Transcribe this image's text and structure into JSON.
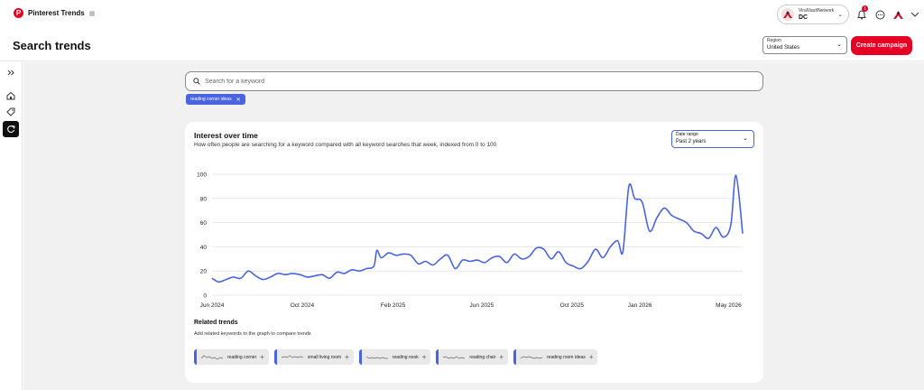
{
  "app": {
    "title": "Pinterest Trends",
    "beta_icon": "grid-icon",
    "logo": "P"
  },
  "account": {
    "network": "ViralVaultNetwork",
    "name": "DC"
  },
  "notifications": {
    "count": "1"
  },
  "page": {
    "title": "Search trends"
  },
  "region": {
    "label": "Region",
    "value": "United States"
  },
  "actions": {
    "create_campaign": "Create campaign"
  },
  "search": {
    "placeholder": "Search for a keyword",
    "value": ""
  },
  "selected_keywords": [
    {
      "label": "reading corner ideas"
    }
  ],
  "interest": {
    "title": "Interest over time",
    "subtitle": "How often people are searching for a keyword compared with all keyword searches that week, indexed from 0 to 100",
    "date_range_label": "Date range",
    "date_range_value": "Past 2 years"
  },
  "related": {
    "title": "Related trends",
    "subtitle": "Add related keywords to the graph to compare trends",
    "items": [
      {
        "label": "reading corner"
      },
      {
        "label": "small living room"
      },
      {
        "label": "reading nook"
      },
      {
        "label": "reading chair"
      },
      {
        "label": "reading room ideas"
      }
    ]
  },
  "colors": {
    "accent": "#e60023",
    "series": "#4a63e0",
    "grid": "#e3e3e3"
  },
  "chart_data": {
    "type": "line",
    "title": "",
    "xlabel": "",
    "ylabel": "",
    "ylim": [
      0,
      100
    ],
    "xlim": [
      "2024-06-01",
      "2026-05-20"
    ],
    "yticks": [
      0,
      20,
      40,
      60,
      80,
      100
    ],
    "xticks": [
      {
        "date": "2024-06-01",
        "label": "Jun 2024"
      },
      {
        "date": "2024-10-01",
        "label": "Oct 2024"
      },
      {
        "date": "2025-02-01",
        "label": "Feb 2025"
      },
      {
        "date": "2025-06-01",
        "label": "Jun 2025"
      },
      {
        "date": "2025-10-01",
        "label": "Oct 2025"
      },
      {
        "date": "2026-01-01",
        "label": "Jan 2026"
      },
      {
        "date": "2026-05-01",
        "label": "May 2026"
      }
    ],
    "grid": true,
    "legend": "none",
    "series": [
      {
        "points": [
          [
            "2024-06-01",
            14
          ],
          [
            "2024-06-10",
            11
          ],
          [
            "2024-06-20",
            13
          ],
          [
            "2024-06-30",
            15
          ],
          [
            "2024-07-10",
            14
          ],
          [
            "2024-07-20",
            20
          ],
          [
            "2024-07-30",
            16
          ],
          [
            "2024-08-09",
            13
          ],
          [
            "2024-08-19",
            15
          ],
          [
            "2024-08-29",
            18
          ],
          [
            "2024-09-08",
            17
          ],
          [
            "2024-09-18",
            18
          ],
          [
            "2024-09-28",
            17
          ],
          [
            "2024-10-08",
            15
          ],
          [
            "2024-10-18",
            16
          ],
          [
            "2024-10-28",
            17
          ],
          [
            "2024-11-07",
            14
          ],
          [
            "2024-11-17",
            19
          ],
          [
            "2024-11-27",
            18
          ],
          [
            "2024-12-07",
            21
          ],
          [
            "2024-12-17",
            20
          ],
          [
            "2024-12-27",
            22
          ],
          [
            "2025-01-06",
            24
          ],
          [
            "2025-01-10",
            37
          ],
          [
            "2025-01-16",
            31
          ],
          [
            "2025-01-26",
            35
          ],
          [
            "2025-02-05",
            33
          ],
          [
            "2025-02-15",
            34
          ],
          [
            "2025-02-25",
            33
          ],
          [
            "2025-03-07",
            26
          ],
          [
            "2025-03-17",
            28
          ],
          [
            "2025-03-27",
            25
          ],
          [
            "2025-04-06",
            30
          ],
          [
            "2025-04-16",
            33
          ],
          [
            "2025-04-26",
            22
          ],
          [
            "2025-05-06",
            29
          ],
          [
            "2025-05-16",
            28
          ],
          [
            "2025-05-26",
            29
          ],
          [
            "2025-06-05",
            27
          ],
          [
            "2025-06-15",
            31
          ],
          [
            "2025-06-25",
            32
          ],
          [
            "2025-07-05",
            27
          ],
          [
            "2025-07-15",
            34
          ],
          [
            "2025-07-25",
            30
          ],
          [
            "2025-08-04",
            32
          ],
          [
            "2025-08-14",
            39
          ],
          [
            "2025-08-24",
            38
          ],
          [
            "2025-09-03",
            30
          ],
          [
            "2025-09-13",
            36
          ],
          [
            "2025-09-23",
            27
          ],
          [
            "2025-10-03",
            24
          ],
          [
            "2025-10-13",
            22
          ],
          [
            "2025-10-23",
            28
          ],
          [
            "2025-11-02",
            38
          ],
          [
            "2025-11-12",
            31
          ],
          [
            "2025-11-22",
            40
          ],
          [
            "2025-12-02",
            45
          ],
          [
            "2025-12-09",
            36
          ],
          [
            "2025-12-17",
            90
          ],
          [
            "2025-12-25",
            80
          ],
          [
            "2026-01-04",
            77
          ],
          [
            "2026-01-14",
            53
          ],
          [
            "2026-01-24",
            64
          ],
          [
            "2026-02-03",
            72
          ],
          [
            "2026-02-13",
            66
          ],
          [
            "2026-02-23",
            63
          ],
          [
            "2026-03-05",
            60
          ],
          [
            "2026-03-15",
            53
          ],
          [
            "2026-03-25",
            51
          ],
          [
            "2026-04-04",
            47
          ],
          [
            "2026-04-14",
            56
          ],
          [
            "2026-04-24",
            48
          ],
          [
            "2026-05-04",
            58
          ],
          [
            "2026-05-11",
            99
          ],
          [
            "2026-05-20",
            51
          ]
        ]
      }
    ]
  }
}
